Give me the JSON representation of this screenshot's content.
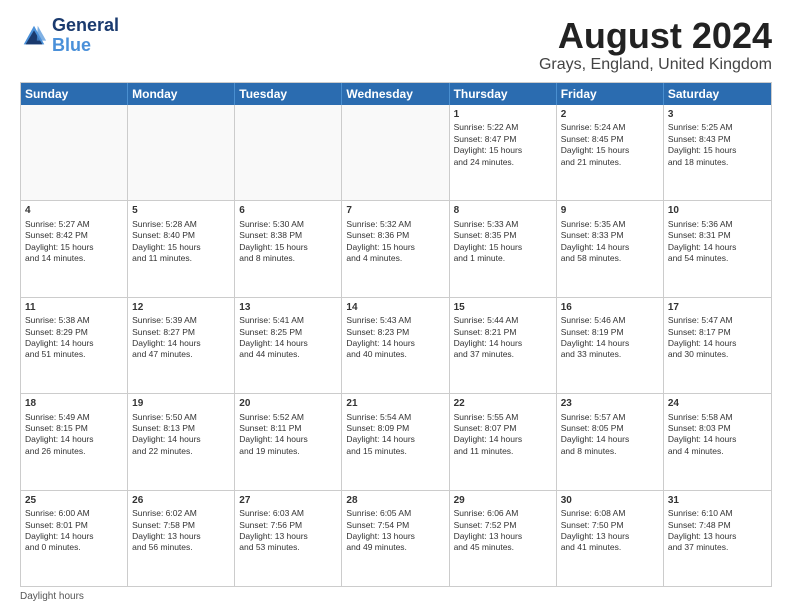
{
  "header": {
    "logo_line1": "General",
    "logo_line2": "Blue",
    "main_title": "August 2024",
    "subtitle": "Grays, England, United Kingdom"
  },
  "calendar": {
    "days_of_week": [
      "Sunday",
      "Monday",
      "Tuesday",
      "Wednesday",
      "Thursday",
      "Friday",
      "Saturday"
    ],
    "weeks": [
      [
        {
          "day": "",
          "empty": true
        },
        {
          "day": "",
          "empty": true
        },
        {
          "day": "",
          "empty": true
        },
        {
          "day": "",
          "empty": true
        },
        {
          "day": "1",
          "lines": [
            "Sunrise: 5:22 AM",
            "Sunset: 8:47 PM",
            "Daylight: 15 hours",
            "and 24 minutes."
          ]
        },
        {
          "day": "2",
          "lines": [
            "Sunrise: 5:24 AM",
            "Sunset: 8:45 PM",
            "Daylight: 15 hours",
            "and 21 minutes."
          ]
        },
        {
          "day": "3",
          "lines": [
            "Sunrise: 5:25 AM",
            "Sunset: 8:43 PM",
            "Daylight: 15 hours",
            "and 18 minutes."
          ]
        }
      ],
      [
        {
          "day": "4",
          "lines": [
            "Sunrise: 5:27 AM",
            "Sunset: 8:42 PM",
            "Daylight: 15 hours",
            "and 14 minutes."
          ]
        },
        {
          "day": "5",
          "lines": [
            "Sunrise: 5:28 AM",
            "Sunset: 8:40 PM",
            "Daylight: 15 hours",
            "and 11 minutes."
          ]
        },
        {
          "day": "6",
          "lines": [
            "Sunrise: 5:30 AM",
            "Sunset: 8:38 PM",
            "Daylight: 15 hours",
            "and 8 minutes."
          ]
        },
        {
          "day": "7",
          "lines": [
            "Sunrise: 5:32 AM",
            "Sunset: 8:36 PM",
            "Daylight: 15 hours",
            "and 4 minutes."
          ]
        },
        {
          "day": "8",
          "lines": [
            "Sunrise: 5:33 AM",
            "Sunset: 8:35 PM",
            "Daylight: 15 hours",
            "and 1 minute."
          ]
        },
        {
          "day": "9",
          "lines": [
            "Sunrise: 5:35 AM",
            "Sunset: 8:33 PM",
            "Daylight: 14 hours",
            "and 58 minutes."
          ]
        },
        {
          "day": "10",
          "lines": [
            "Sunrise: 5:36 AM",
            "Sunset: 8:31 PM",
            "Daylight: 14 hours",
            "and 54 minutes."
          ]
        }
      ],
      [
        {
          "day": "11",
          "lines": [
            "Sunrise: 5:38 AM",
            "Sunset: 8:29 PM",
            "Daylight: 14 hours",
            "and 51 minutes."
          ]
        },
        {
          "day": "12",
          "lines": [
            "Sunrise: 5:39 AM",
            "Sunset: 8:27 PM",
            "Daylight: 14 hours",
            "and 47 minutes."
          ]
        },
        {
          "day": "13",
          "lines": [
            "Sunrise: 5:41 AM",
            "Sunset: 8:25 PM",
            "Daylight: 14 hours",
            "and 44 minutes."
          ]
        },
        {
          "day": "14",
          "lines": [
            "Sunrise: 5:43 AM",
            "Sunset: 8:23 PM",
            "Daylight: 14 hours",
            "and 40 minutes."
          ]
        },
        {
          "day": "15",
          "lines": [
            "Sunrise: 5:44 AM",
            "Sunset: 8:21 PM",
            "Daylight: 14 hours",
            "and 37 minutes."
          ]
        },
        {
          "day": "16",
          "lines": [
            "Sunrise: 5:46 AM",
            "Sunset: 8:19 PM",
            "Daylight: 14 hours",
            "and 33 minutes."
          ]
        },
        {
          "day": "17",
          "lines": [
            "Sunrise: 5:47 AM",
            "Sunset: 8:17 PM",
            "Daylight: 14 hours",
            "and 30 minutes."
          ]
        }
      ],
      [
        {
          "day": "18",
          "lines": [
            "Sunrise: 5:49 AM",
            "Sunset: 8:15 PM",
            "Daylight: 14 hours",
            "and 26 minutes."
          ]
        },
        {
          "day": "19",
          "lines": [
            "Sunrise: 5:50 AM",
            "Sunset: 8:13 PM",
            "Daylight: 14 hours",
            "and 22 minutes."
          ]
        },
        {
          "day": "20",
          "lines": [
            "Sunrise: 5:52 AM",
            "Sunset: 8:11 PM",
            "Daylight: 14 hours",
            "and 19 minutes."
          ]
        },
        {
          "day": "21",
          "lines": [
            "Sunrise: 5:54 AM",
            "Sunset: 8:09 PM",
            "Daylight: 14 hours",
            "and 15 minutes."
          ]
        },
        {
          "day": "22",
          "lines": [
            "Sunrise: 5:55 AM",
            "Sunset: 8:07 PM",
            "Daylight: 14 hours",
            "and 11 minutes."
          ]
        },
        {
          "day": "23",
          "lines": [
            "Sunrise: 5:57 AM",
            "Sunset: 8:05 PM",
            "Daylight: 14 hours",
            "and 8 minutes."
          ]
        },
        {
          "day": "24",
          "lines": [
            "Sunrise: 5:58 AM",
            "Sunset: 8:03 PM",
            "Daylight: 14 hours",
            "and 4 minutes."
          ]
        }
      ],
      [
        {
          "day": "25",
          "lines": [
            "Sunrise: 6:00 AM",
            "Sunset: 8:01 PM",
            "Daylight: 14 hours",
            "and 0 minutes."
          ]
        },
        {
          "day": "26",
          "lines": [
            "Sunrise: 6:02 AM",
            "Sunset: 7:58 PM",
            "Daylight: 13 hours",
            "and 56 minutes."
          ]
        },
        {
          "day": "27",
          "lines": [
            "Sunrise: 6:03 AM",
            "Sunset: 7:56 PM",
            "Daylight: 13 hours",
            "and 53 minutes."
          ]
        },
        {
          "day": "28",
          "lines": [
            "Sunrise: 6:05 AM",
            "Sunset: 7:54 PM",
            "Daylight: 13 hours",
            "and 49 minutes."
          ]
        },
        {
          "day": "29",
          "lines": [
            "Sunrise: 6:06 AM",
            "Sunset: 7:52 PM",
            "Daylight: 13 hours",
            "and 45 minutes."
          ]
        },
        {
          "day": "30",
          "lines": [
            "Sunrise: 6:08 AM",
            "Sunset: 7:50 PM",
            "Daylight: 13 hours",
            "and 41 minutes."
          ]
        },
        {
          "day": "31",
          "lines": [
            "Sunrise: 6:10 AM",
            "Sunset: 7:48 PM",
            "Daylight: 13 hours",
            "and 37 minutes."
          ]
        }
      ]
    ]
  },
  "footer": {
    "note": "Daylight hours"
  }
}
